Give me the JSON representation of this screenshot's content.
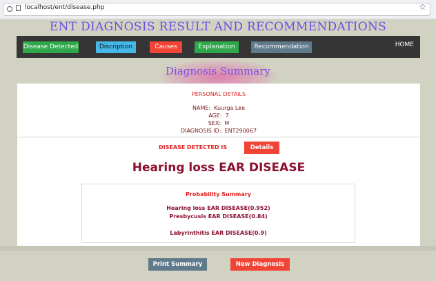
{
  "browser": {
    "url": "localhost/ent/disease.php"
  },
  "page_title": "ENT DIAGNOSIS RESULT AND RECOMMENDATIONS",
  "nav": {
    "items": [
      {
        "label": "Disease Detected",
        "color": "#2ea84a"
      },
      {
        "label": "Discription",
        "color": "#46b8e8"
      },
      {
        "label": "Causes",
        "color": "#f24436"
      },
      {
        "label": "Explanation",
        "color": "#2ea84a"
      },
      {
        "label": "Recommendation",
        "color": "#5f7a8b"
      }
    ],
    "home": "HOME"
  },
  "summary_title": "Diagnosis Summary",
  "personal": {
    "heading": "PERSONAL DETAILS",
    "name": "NAME:  Kuurga Lee",
    "age": "AGE:  7",
    "sex": "SEX:  M",
    "diagnosis_id": "DIAGNOSIS ID:  ENT290067"
  },
  "detected": {
    "label": "DISEASE DETECTED IS",
    "details_button": "Details",
    "disease": "Hearing loss EAR DISEASE"
  },
  "probability": {
    "heading": "Probability Summary",
    "items": [
      "Hearing loss EAR DISEASE(0.952)",
      "Presbycusis EAR DISEASE(0.84)",
      "Labyrinthitis EAR DISEASE(0.9)"
    ]
  },
  "actions": {
    "print": "Print Summary",
    "new": "New Diagnosis"
  },
  "colors": {
    "background": "#d2d2c2",
    "title": "#6a4ee6",
    "nav_bar": "#353535",
    "accent_red": "#f24436",
    "disease": "#8b1030",
    "print_button": "#5f7a8b"
  }
}
